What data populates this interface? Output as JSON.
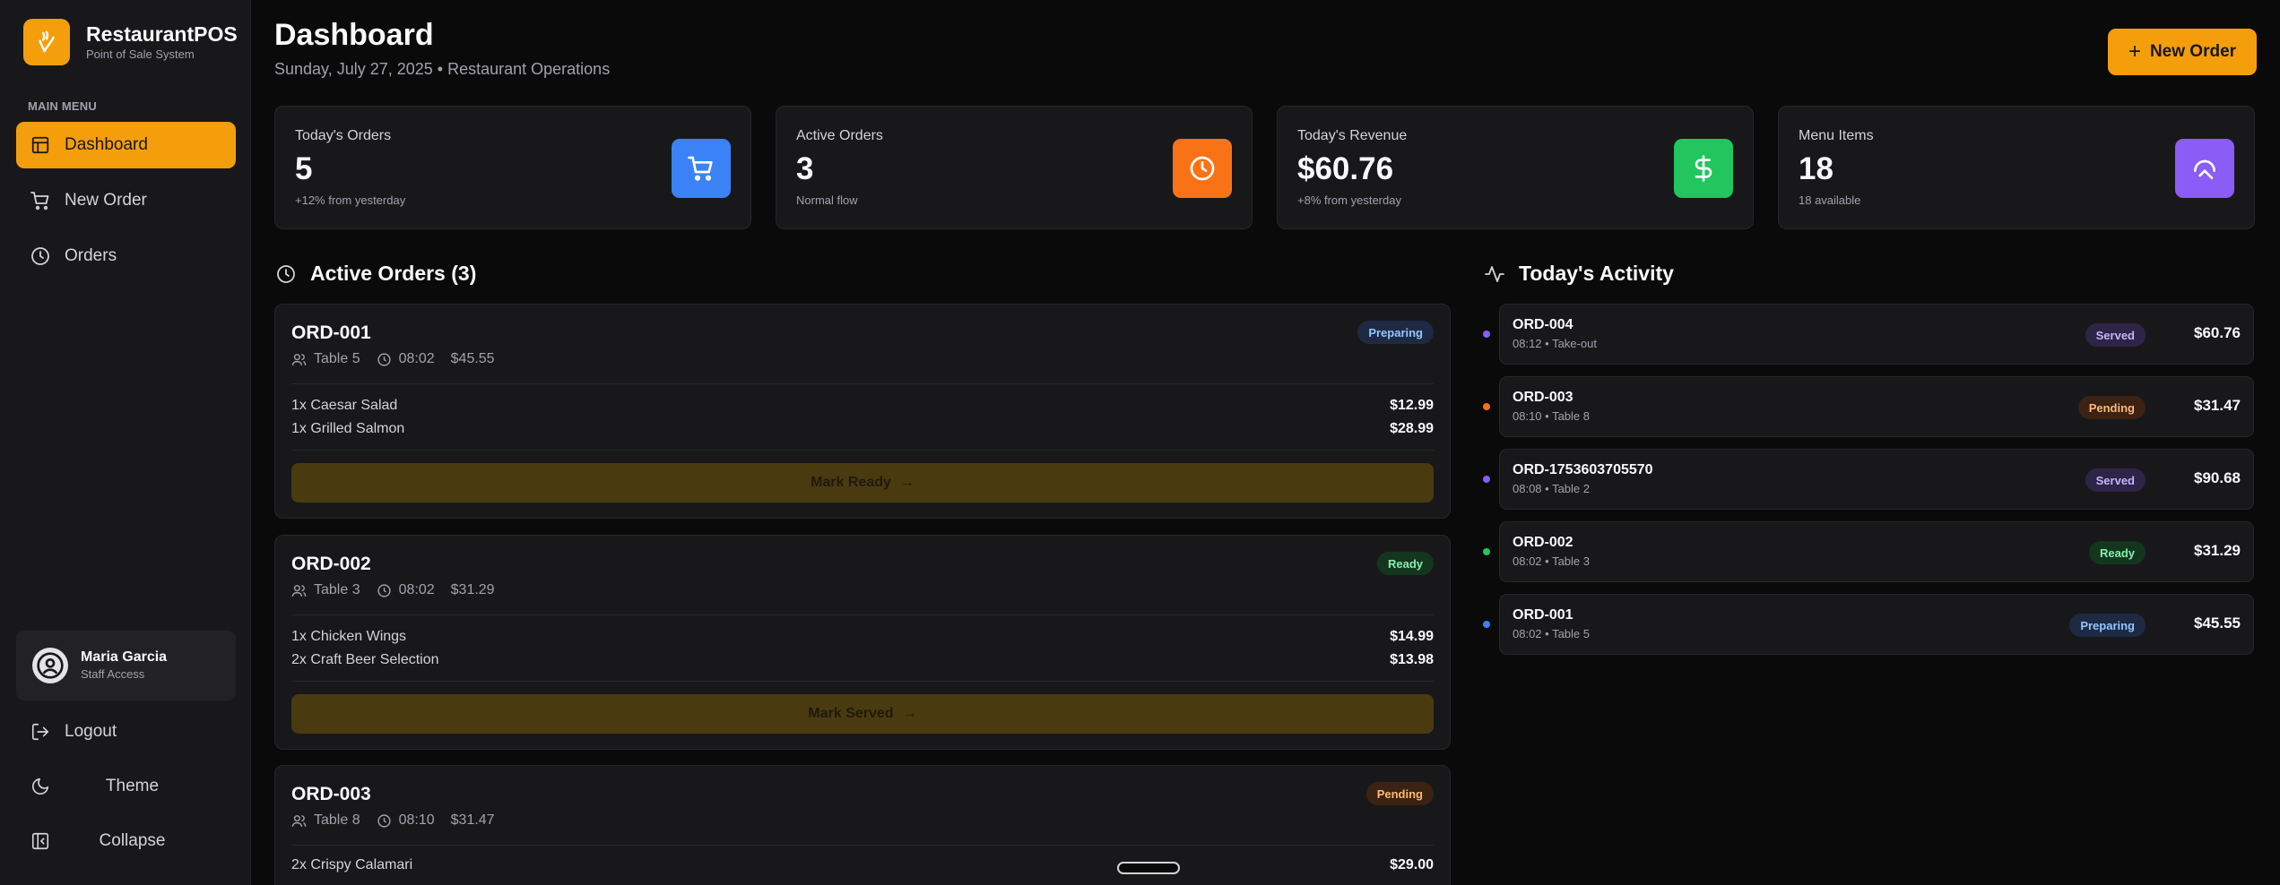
{
  "brand": {
    "name": "RestaurantPOS",
    "subtitle": "Point of Sale System",
    "accent": "#f59e0b"
  },
  "sidebar": {
    "menu_title": "MAIN MENU",
    "items": [
      {
        "label": "Dashboard",
        "icon": "layout-icon",
        "active": true
      },
      {
        "label": "New Order",
        "icon": "cart-icon",
        "active": false
      },
      {
        "label": "Orders",
        "icon": "clock-icon",
        "active": false
      }
    ],
    "user": {
      "name": "Maria Garcia",
      "role": "Staff Access"
    },
    "bottom": {
      "logout": "Logout",
      "theme": "Theme",
      "collapse": "Collapse"
    }
  },
  "header": {
    "title": "Dashboard",
    "subtitle": "Sunday, July 27, 2025 • Restaurant Operations",
    "new_order_label": "New Order"
  },
  "stats": [
    {
      "label": "Today's Orders",
      "value": "5",
      "note": "+12% from yesterday",
      "icon": "cart-icon",
      "color": "#3b82f6"
    },
    {
      "label": "Active Orders",
      "value": "3",
      "note": "Normal flow",
      "icon": "clock-icon",
      "color": "#f97316"
    },
    {
      "label": "Today's Revenue",
      "value": "$60.76",
      "note": "+8% from yesterday",
      "icon": "dollar-icon",
      "color": "#22c55e"
    },
    {
      "label": "Menu Items",
      "value": "18",
      "note": "18 available",
      "icon": "chef-icon",
      "color": "#8b5cf6"
    }
  ],
  "active_orders": {
    "title": "Active Orders (3)",
    "orders": [
      {
        "id": "ORD-001",
        "table": "Table 5",
        "time": "08:02",
        "total": "$45.55",
        "status": "Preparing",
        "items": [
          {
            "name": "1x Caesar Salad",
            "price": "$12.99"
          },
          {
            "name": "1x Grilled Salmon",
            "price": "$28.99"
          }
        ],
        "action": "Mark Ready"
      },
      {
        "id": "ORD-002",
        "table": "Table 3",
        "time": "08:02",
        "total": "$31.29",
        "status": "Ready",
        "items": [
          {
            "name": "1x Chicken Wings",
            "price": "$14.99"
          },
          {
            "name": "2x Craft Beer Selection",
            "price": "$13.98"
          }
        ],
        "action": "Mark Served"
      },
      {
        "id": "ORD-003",
        "table": "Table 8",
        "time": "08:10",
        "total": "$31.47",
        "status": "Pending",
        "items": [
          {
            "name": "2x Crispy Calamari",
            "price": "$29.00"
          }
        ]
      }
    ]
  },
  "activity": {
    "title": "Today's Activity",
    "items": [
      {
        "id": "ORD-004",
        "sub": "08:12 • Take-out",
        "status": "Served",
        "amount": "$60.76",
        "dot": "#8b5cf6"
      },
      {
        "id": "ORD-003",
        "sub": "08:10 • Table 8",
        "status": "Pending",
        "amount": "$31.47",
        "dot": "#f97316"
      },
      {
        "id": "ORD-1753603705570",
        "sub": "08:08 • Table 2",
        "status": "Served",
        "amount": "$90.68",
        "dot": "#8b5cf6"
      },
      {
        "id": "ORD-002",
        "sub": "08:02 • Table 3",
        "status": "Ready",
        "amount": "$31.29",
        "dot": "#22c55e"
      },
      {
        "id": "ORD-001",
        "sub": "08:02 • Table 5",
        "status": "Preparing",
        "amount": "$45.55",
        "dot": "#3b82f6"
      }
    ]
  }
}
